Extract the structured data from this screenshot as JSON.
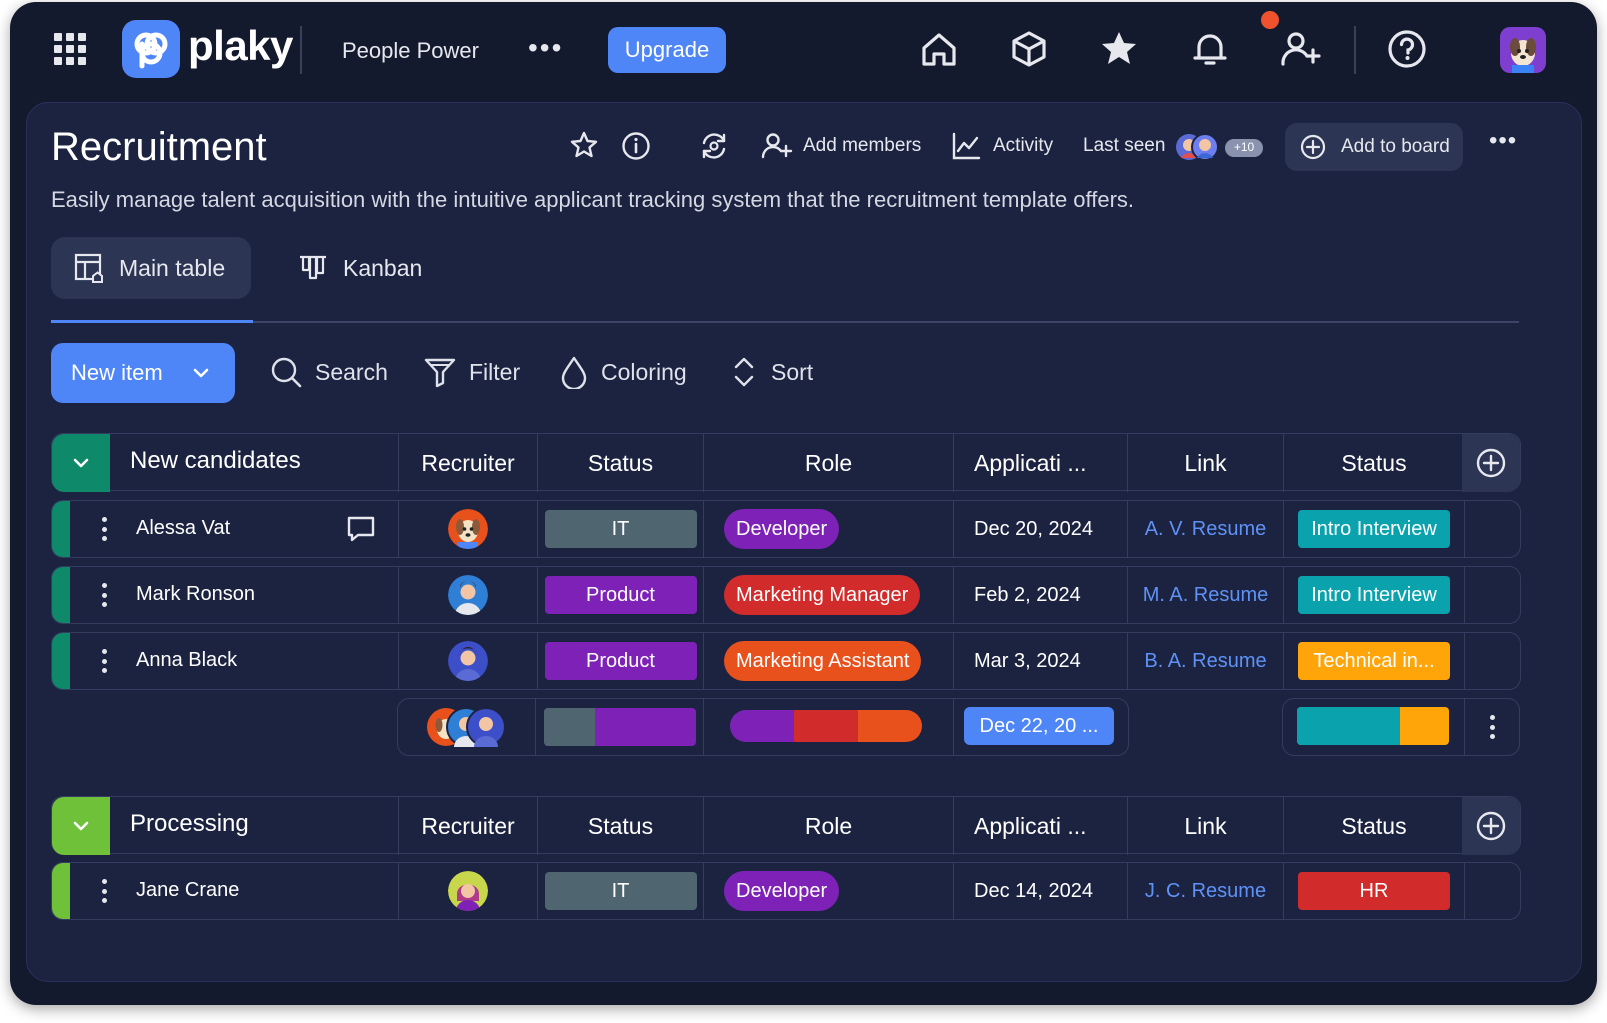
{
  "topbar": {
    "logo_text": "plaky",
    "workspace": "People Power",
    "more": "•••",
    "upgrade": "Upgrade"
  },
  "board": {
    "title": "Recruitment",
    "add_members": "Add members",
    "activity": "Activity",
    "last_seen": "Last seen",
    "last_seen_more": "+10",
    "add_to_board": "Add to board",
    "more": "•••",
    "description": "Easily manage talent acquisition with the intuitive applicant tracking system that the recruitment template offers."
  },
  "tabs": [
    {
      "label": "Main table",
      "active": true
    },
    {
      "label": "Kanban",
      "active": false
    }
  ],
  "toolbar": {
    "new_item": "New item",
    "search": "Search",
    "filter": "Filter",
    "coloring": "Coloring",
    "sort": "Sort"
  },
  "columns": [
    "Recruiter",
    "Status",
    "Role",
    "Applicati ...",
    "Link",
    "Status"
  ],
  "colors": {
    "accent": "#4e86f7",
    "group1": "#0e8a6b",
    "group2": "#6fc13a",
    "it": "#4f6670",
    "product": "#7e22b7",
    "developer": "#7e22b7",
    "marketing_manager": "#d12b2b",
    "marketing_assistant": "#e8501c",
    "intro_interview": "#0aa3ad",
    "technical": "#ffa50a",
    "hr": "#d12b2b",
    "date_summary": "#4e86f7"
  },
  "groups": [
    {
      "name": "New candidates",
      "rows": [
        {
          "name": "Alessa Vat",
          "status1": "IT",
          "role": "Developer",
          "date": "Dec 20, 2024",
          "link": "A. V. Resume",
          "status2": "Intro Interview"
        },
        {
          "name": "Mark Ronson",
          "status1": "Product",
          "role": "Marketing Manager",
          "date": "Feb 2, 2024",
          "link": "M. A. Resume",
          "status2": "Intro Interview"
        },
        {
          "name": "Anna Black",
          "status1": "Product",
          "role": "Marketing Assistant",
          "date": "Mar 3, 2024",
          "link": "B. A. Resume",
          "status2": "Technical in..."
        }
      ],
      "summary_date": "Dec 22, 20 ..."
    },
    {
      "name": "Processing",
      "rows": [
        {
          "name": "Jane Crane",
          "status1": "IT",
          "role": "Developer",
          "date": "Dec 14, 2024",
          "link": "J. C. Resume",
          "status2": "HR"
        }
      ]
    }
  ]
}
